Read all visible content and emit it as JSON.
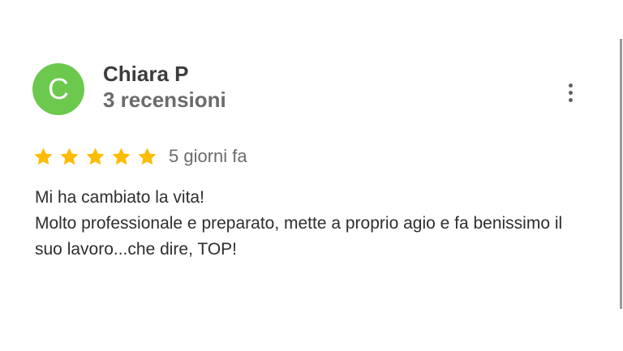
{
  "review": {
    "author": {
      "initial": "C",
      "name": "Chiara P",
      "reviews_count": "3 recensioni",
      "avatar_color": "#6cc94e"
    },
    "rating": 5,
    "max_rating": 5,
    "star_color": "#fbbc04",
    "time_ago": "5 giorni fa",
    "text_lines": [
      "Mi ha cambiato la vita!",
      "Molto professionale e preparato, mette a proprio agio e fa benissimo il suo lavoro...che dire, TOP!"
    ]
  },
  "menu": {
    "icon": "more-vert-icon"
  }
}
